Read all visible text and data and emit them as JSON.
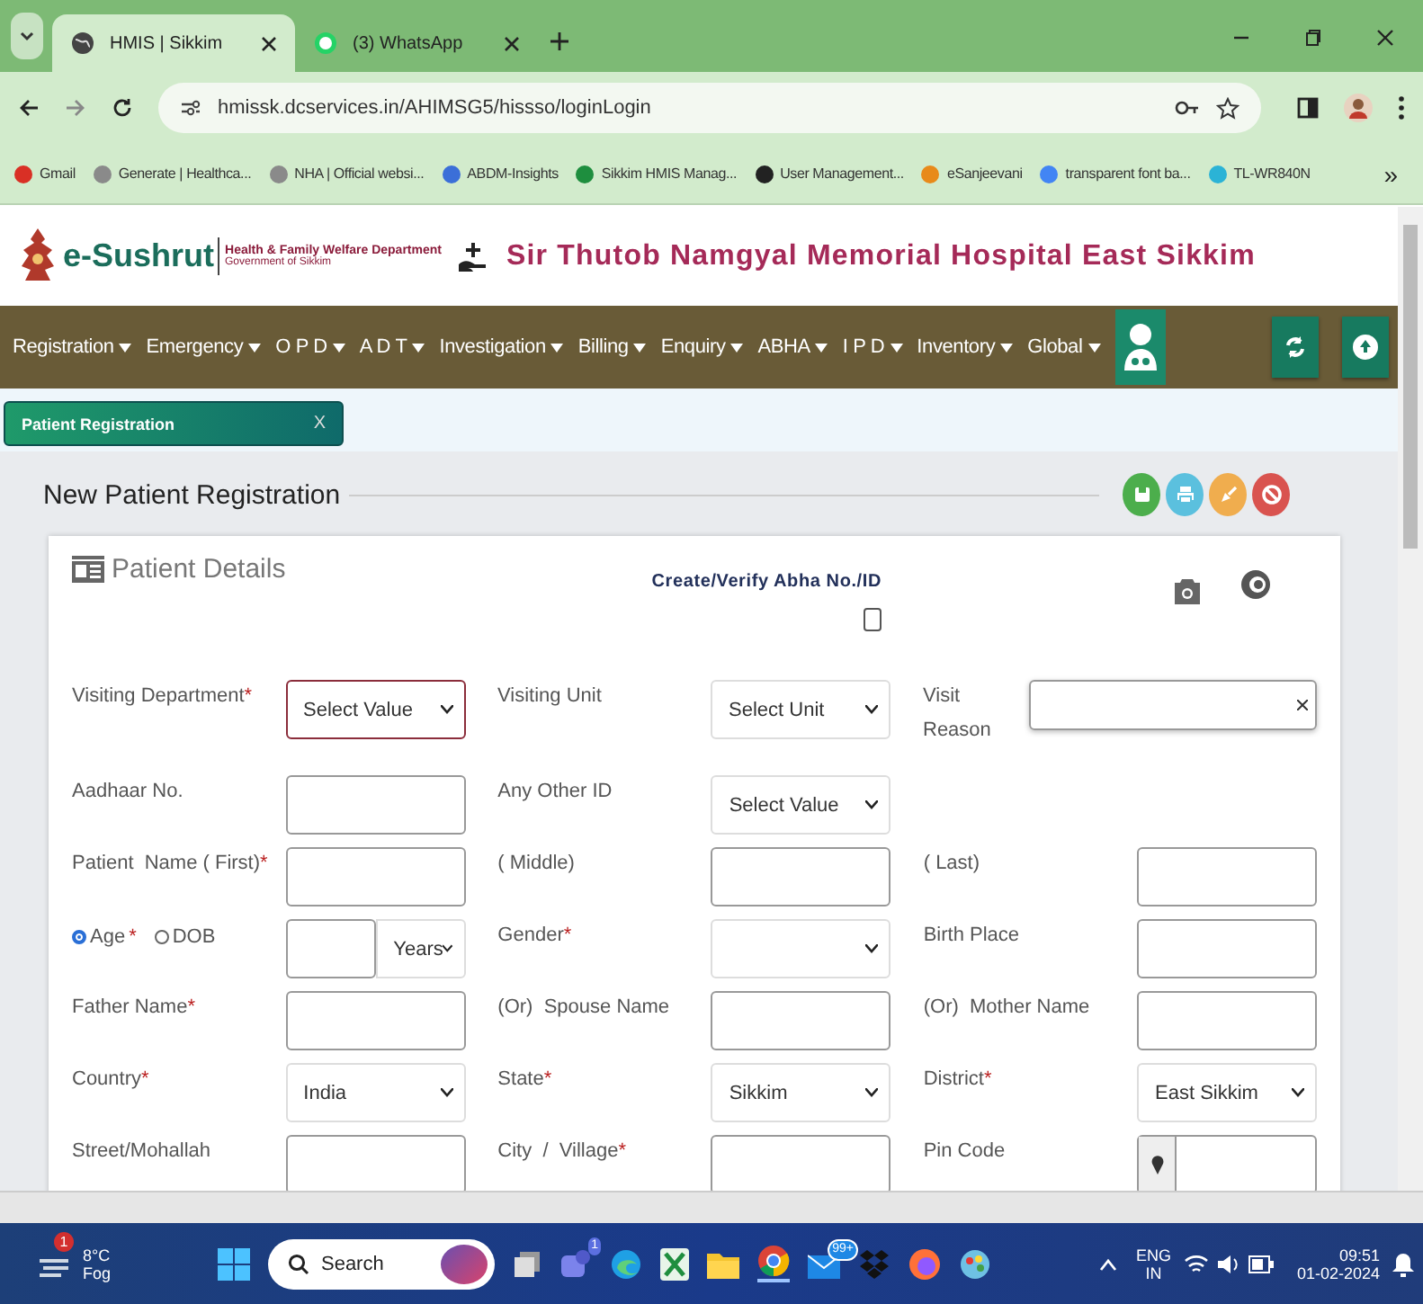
{
  "browser": {
    "tabs": [
      {
        "title": "HMIS | Sikkim",
        "selected": true
      },
      {
        "title": "(3) WhatsApp",
        "selected": false
      }
    ],
    "url": "hmissk.dcservices.in/AHIMSG5/hissso/loginLogin",
    "bookmarks": [
      {
        "label": "Gmail",
        "color": "#d93025"
      },
      {
        "label": "Generate | Healthca...",
        "color": "#8a8a8a"
      },
      {
        "label": "NHA | Official websi...",
        "color": "#8a8a8a"
      },
      {
        "label": "ABDM-Insights",
        "color": "#3b6fd8"
      },
      {
        "label": "Sikkim HMIS Manag...",
        "color": "#1e8e3e"
      },
      {
        "label": "User Management...",
        "color": "#222222"
      },
      {
        "label": "eSanjeevani",
        "color": "#e88a1a"
      },
      {
        "label": "transparent font ba...",
        "color": "#4285f4"
      },
      {
        "label": "TL-WR840N",
        "color": "#2bb3d6"
      }
    ],
    "bookmarks_more": "»"
  },
  "header": {
    "brand": "e-Sushrut",
    "dept": "Health & Family Welfare Department",
    "govt": "Government of Sikkim",
    "hospital": "Sir Thutob Namgyal Memorial Hospital East Sikkim"
  },
  "nav": {
    "items": [
      "Registration",
      "Emergency",
      "O P D",
      "A D T",
      "Investigation",
      "Billing",
      "Enquiry",
      "ABHA",
      "I P D",
      "Inventory",
      "Global"
    ]
  },
  "page_tab": {
    "label": "Patient Registration",
    "close": "X"
  },
  "form": {
    "title": "New Patient Registration",
    "section": "Patient Details",
    "abha": {
      "label": "Create/Verify Abha No./ID",
      "checked": false
    },
    "rows": [
      [
        {
          "kind": "select",
          "label": "Visiting Department",
          "mark": "*",
          "value": "Select Value",
          "focused": true
        },
        {
          "kind": "select",
          "label": "Visiting Unit",
          "value": "Select Unit",
          "focused": false
        },
        {
          "kind": "textarea",
          "label": "Visit Reason"
        }
      ],
      [
        {
          "kind": "input",
          "label": "Aadhaar No."
        },
        {
          "kind": "select",
          "label": "Any Other ID",
          "value": "Select Value",
          "focused": false
        },
        {
          "kind": "empty"
        }
      ],
      [
        {
          "kind": "input",
          "label": "Patient  Name ( First)",
          "mark": "*"
        },
        {
          "kind": "input",
          "label": "( Middle)"
        },
        {
          "kind": "input",
          "label": "( Last)"
        }
      ],
      [
        {
          "kind": "age",
          "options": [
            {
              "label": "Age",
              "mark": "*",
              "selected": true
            },
            {
              "label": "DOB",
              "selected": false
            }
          ],
          "unit": "Years"
        },
        {
          "kind": "select",
          "label": "Gender",
          "mark": "*",
          "focused": false
        },
        {
          "kind": "input",
          "label": "Birth Place"
        }
      ],
      [
        {
          "kind": "input",
          "label": "Father Name",
          "mark": "*"
        },
        {
          "kind": "input",
          "label": "(Or)  Spouse Name"
        },
        {
          "kind": "input",
          "label": "(Or)  Mother Name"
        }
      ],
      [
        {
          "kind": "select",
          "label": "Country",
          "mark": "*",
          "value": "India",
          "focused": false
        },
        {
          "kind": "select",
          "label": "State",
          "mark": "*",
          "value": "Sikkim",
          "focused": false
        },
        {
          "kind": "select",
          "label": "District",
          "mark": "*",
          "value": "East Sikkim",
          "focused": false
        }
      ],
      [
        {
          "kind": "input",
          "label": "Street/Mohallah"
        },
        {
          "kind": "input",
          "label": "City  /  Village",
          "mark": "*"
        },
        {
          "kind": "pin",
          "label": "Pin Code"
        }
      ]
    ]
  },
  "taskbar": {
    "temp": "8°C",
    "weather": "Fog",
    "weather_badge": "1",
    "search_placeholder": "Search",
    "teams_badge": "1",
    "mail_badge": "99+",
    "lang": "ENG",
    "region": "IN",
    "time": "09:51",
    "date": "01-02-2024"
  }
}
